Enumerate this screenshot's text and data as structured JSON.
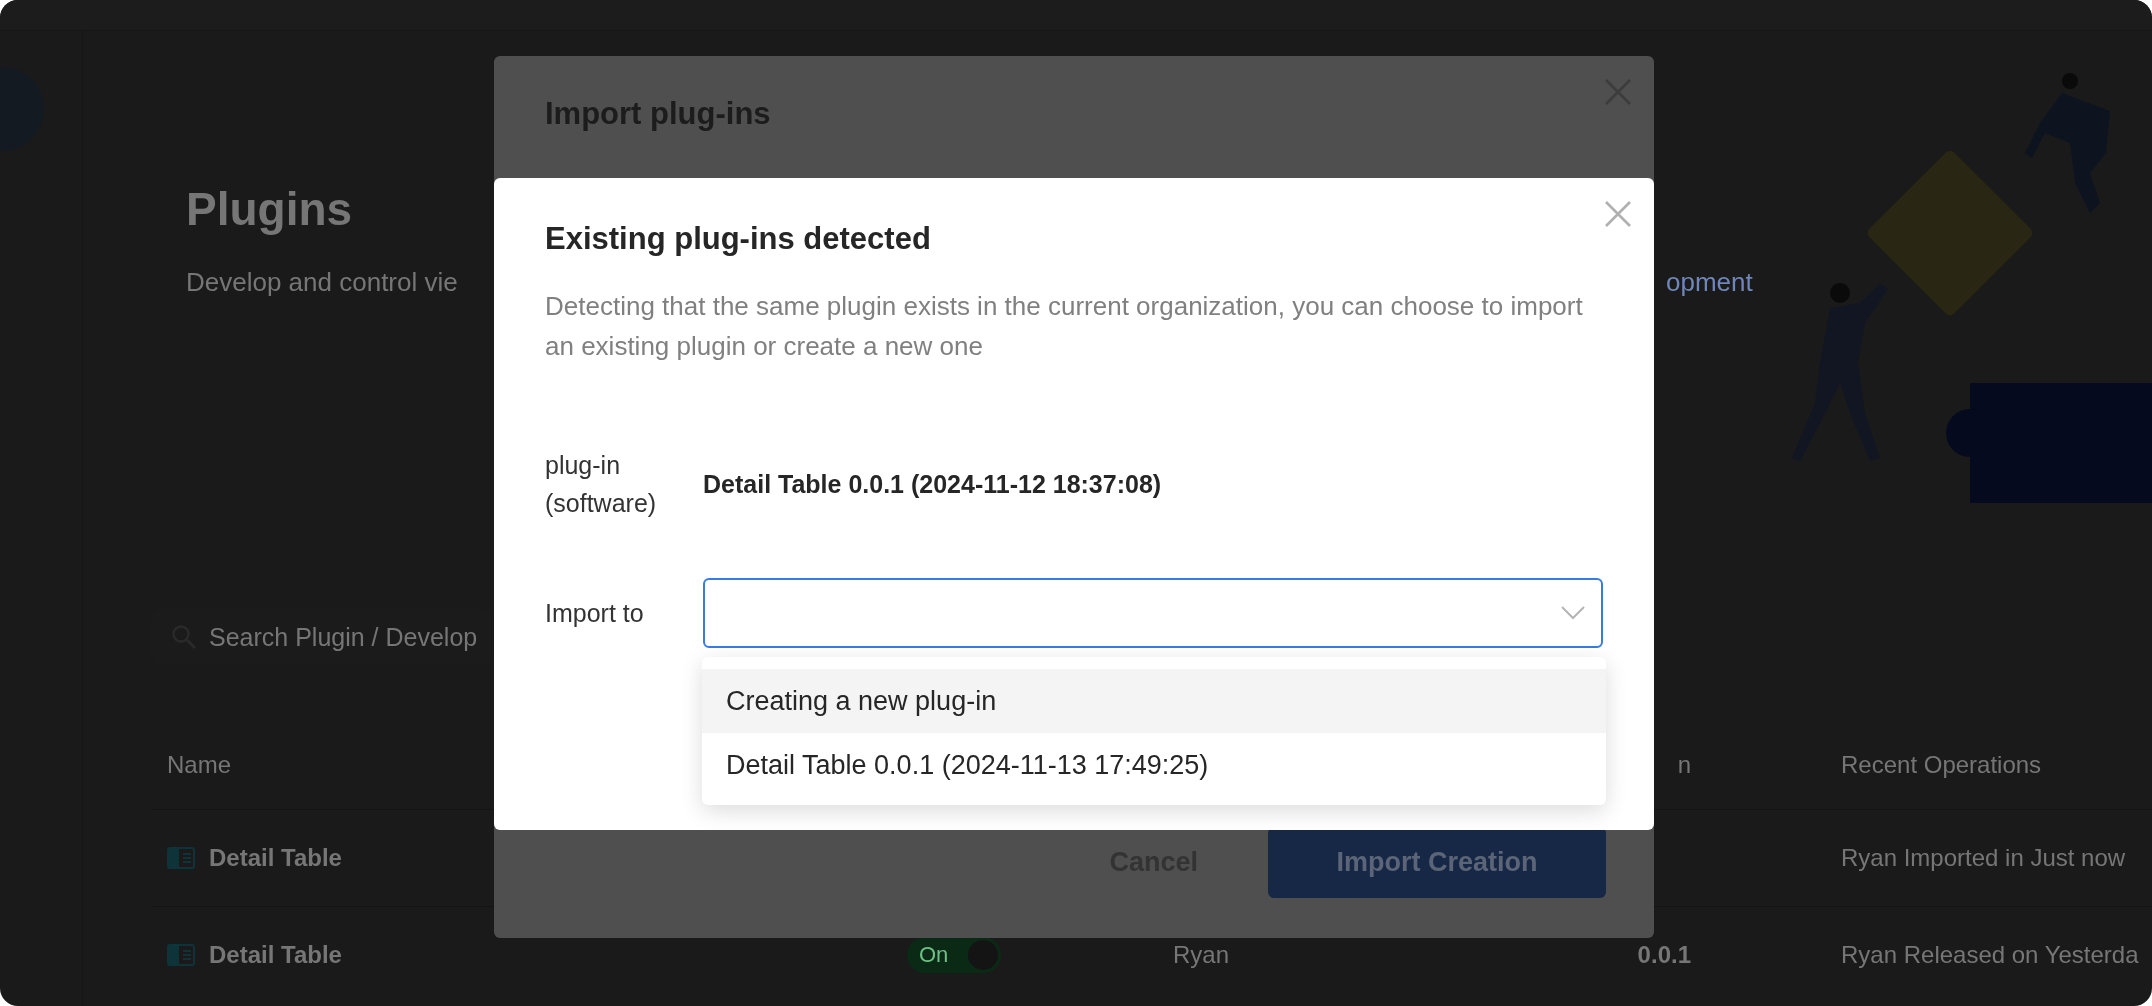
{
  "page": {
    "title": "Plugins",
    "subtitle_start": "Develop and control vie",
    "subtitle_link_end": "opment",
    "search": {
      "placeholder": "Search Plugin / Develop"
    }
  },
  "table": {
    "header": {
      "name": "Name",
      "version": "n",
      "operation": "Recent Operations"
    },
    "rows": [
      {
        "name": "Detail Table",
        "operation": "Ryan Imported in Just now"
      },
      {
        "name": "Detail Table",
        "status": {
          "label": "On",
          "on": true
        },
        "owner": "Ryan",
        "version": "0.0.1",
        "operation": "Ryan Released on Yesterda"
      }
    ]
  },
  "back_dialog": {
    "title": "Import plug-ins",
    "buttons": [
      {
        "label": "Cancel",
        "kind": "secondary"
      },
      {
        "label": "Import Creation",
        "kind": "primary"
      }
    ]
  },
  "front_dialog": {
    "title": "Existing plug-ins detected",
    "description": "Detecting that the same plugin exists in the current organization, you can choose to import an existing plugin or create a new one",
    "field": {
      "label": "plug-in (software)",
      "value": "Detail Table 0.0.1 (2024-11-12 18:37:08)"
    },
    "select": {
      "label": "Import to",
      "open": true,
      "options": [
        {
          "label": "Creating a new plug-in",
          "highlighted": true
        },
        {
          "label": "Detail Table 0.0.1 (2024-11-13 17:49:25)",
          "highlighted": false
        }
      ]
    }
  }
}
